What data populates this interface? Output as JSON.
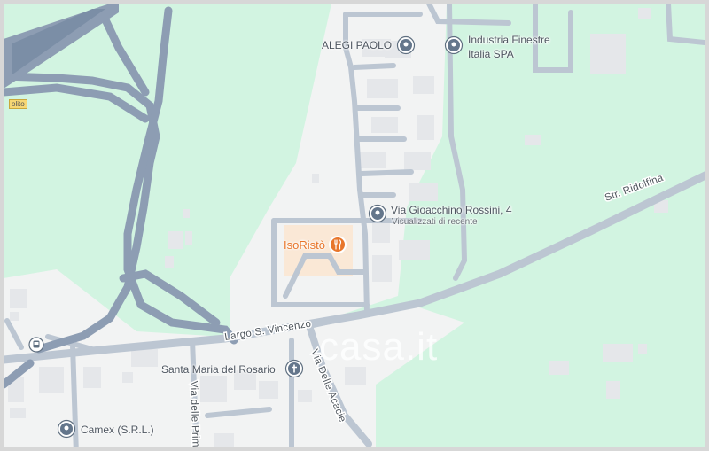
{
  "map": {
    "colors": {
      "land_green": "#d2f4e1",
      "urban_gray": "#f2f3f3",
      "road_fill": "#bcc6d2",
      "major_road": "#8b9bb1",
      "building": "#e6e8ea",
      "restaurant": "#e8762b",
      "pin": "#5f6f80"
    },
    "road_labels": {
      "largo": "Largo S. Vincenzo",
      "ridolfina": "Str. Ridolfina",
      "acacie": "Via Delle Acacie",
      "primule": "Via delle Primule"
    },
    "pois": {
      "alegi": {
        "name": "ALEGI PAOLO",
        "icon": "place-pin-icon"
      },
      "industria_line1": "Industria Finestre",
      "industria_line2": "Italia SPA",
      "rossini": {
        "name": "Via Gioacchino Rossini, 4",
        "subtitle": "Visualizzati di recente",
        "icon": "place-pin-icon"
      },
      "isoristo": {
        "name": "IsoRistò",
        "icon": "restaurant-icon"
      },
      "santa_maria": {
        "name": "Santa Maria del Rosario",
        "icon": "church-cross-icon"
      },
      "camex": {
        "name": "Camex (S.R.L.)",
        "icon": "place-pin-icon"
      },
      "bus_icon": "bus-stop-icon"
    },
    "road_tag": "olito",
    "watermark": "casa.it"
  }
}
